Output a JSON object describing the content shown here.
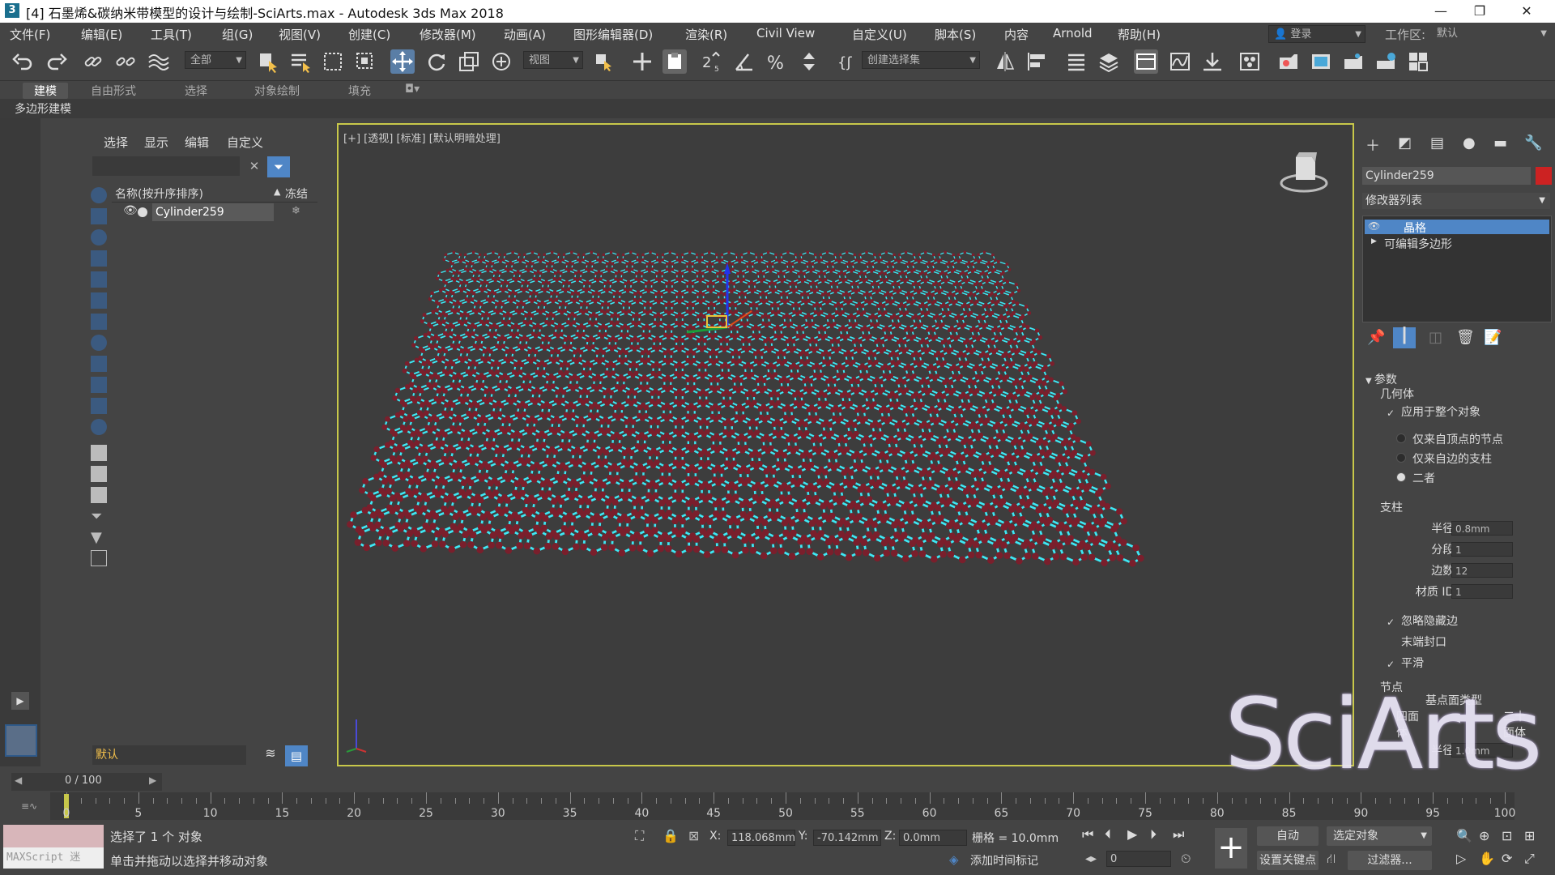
{
  "window": {
    "title": "[4] 石墨烯&碳纳米带模型的设计与绘制-SciArts.max - Autodesk 3ds Max 2018",
    "minimize": "—",
    "restore": "❐",
    "close": "✕"
  },
  "menu": [
    "文件(F)",
    "编辑(E)",
    "工具(T)",
    "组(G)",
    "视图(V)",
    "创建(C)",
    "修改器(M)",
    "动画(A)",
    "图形编辑器(D)",
    "渲染(R)",
    "Civil View",
    "自定义(U)",
    "脚本(S)",
    "内容",
    "Arnold",
    "帮助(H)"
  ],
  "account": {
    "login": "登录",
    "workspace_label": "工作区:",
    "workspace_value": "默认"
  },
  "toolbar": {
    "filter_all": "全部",
    "ref_coord": "视图",
    "selection_set": "创建选择集"
  },
  "ribbon": {
    "tabs": [
      "建模",
      "自由形式",
      "选择",
      "对象绘制",
      "填充"
    ],
    "sub": "多边形建模"
  },
  "scene_explorer": {
    "tabs": [
      "选择",
      "显示",
      "编辑",
      "自定义"
    ],
    "column_name": "名称(按升序排序)",
    "column_sort": "▲",
    "column_freeze": "冻结",
    "object": "Cylinder259",
    "layer": "默认"
  },
  "viewport": {
    "label": "[+] [透视] [标准] [默认明暗处理]"
  },
  "command_panel": {
    "object_name": "Cylinder259",
    "object_color": "#cc2222",
    "modifier_list": "修改器列表",
    "stack": [
      "晶格",
      "可编辑多边形"
    ],
    "params_title": "参数",
    "geometry_label": "几何体",
    "apply_whole": "应用于整个对象",
    "radio_nodes": "仅来自顶点的节点",
    "radio_struts": "仅来自边的支柱",
    "radio_both": "二者",
    "struts_title": "支柱",
    "radius_label": "半径:",
    "radius_value": "0.8mm",
    "segments_label": "分段:",
    "segments_value": "1",
    "sides_label": "边数:",
    "sides_value": "12",
    "matid_label": "材质 ID:",
    "matid_value": "1",
    "ignore_hidden": "忽略隐藏边",
    "end_caps": "末端封口",
    "smooth": "平滑",
    "joints_title": "节点",
    "geodesic_label": "基点面类型",
    "tetra_label": "四面体",
    "octa_label": "二十面体",
    "joint_radius_label": "半径:",
    "joint_radius_value": "1.0mm"
  },
  "timeline": {
    "frame_display": "0 / 100",
    "ticks": [
      0,
      5,
      10,
      15,
      20,
      25,
      30,
      35,
      40,
      45,
      50,
      55,
      60,
      65,
      70,
      75,
      80,
      85,
      90,
      95,
      100
    ]
  },
  "status": {
    "maxscript": "MAXScript 迷",
    "selected": "选择了 1 个 对象",
    "hint": "单击并拖动以选择并移动对象",
    "x_label": "X:",
    "x_value": "118.068mm",
    "y_label": "Y:",
    "y_value": "-70.142mm",
    "z_label": "Z:",
    "z_value": "0.0mm",
    "grid": "栅格 = 10.0mm",
    "add_tag": "添加时间标记",
    "frame_field": "0",
    "auto": "自动",
    "set_key": "设置关键点",
    "selected_obj": "选定对象",
    "filters": "过滤器..."
  },
  "watermark": "SciArts",
  "colors": {
    "viewport_border": "#c8c84a",
    "lattice_highlight": "#3ee8f5",
    "atom_color": "#7a1f2c",
    "selected_stack": "#4f86c6"
  }
}
